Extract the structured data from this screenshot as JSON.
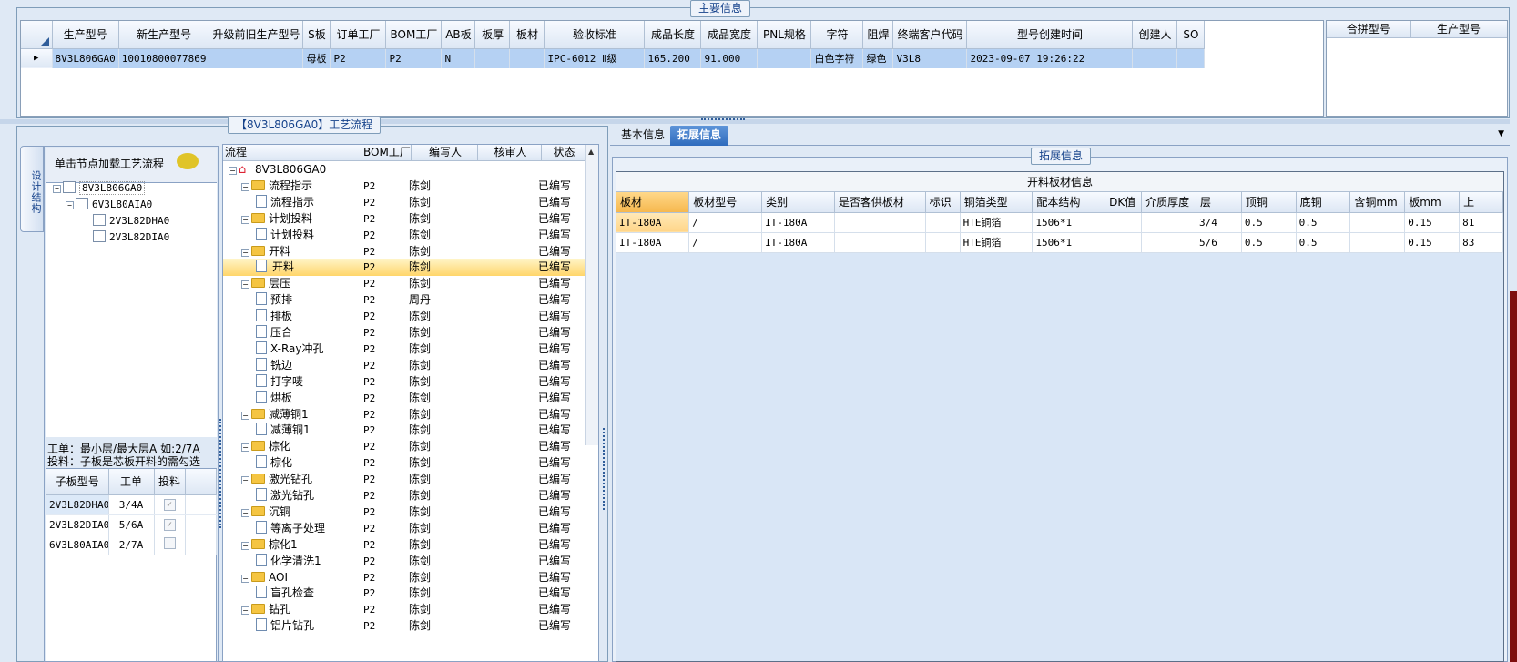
{
  "top": {
    "title": "主要信息",
    "columns": [
      "生产型号",
      "新生产型号",
      "升级前旧生产型号",
      "S板",
      "订单工厂",
      "BOM工厂",
      "AB板",
      "板厚",
      "板材",
      "验收标准",
      "成品长度",
      "成品宽度",
      "PNL规格",
      "字符",
      "阻焊",
      "终端客户代码",
      "型号创建时间",
      "创建人",
      "SO"
    ],
    "row": [
      "8V3L806GA0",
      "10010800077869",
      "",
      "母板",
      "P2",
      "P2",
      "N",
      "",
      "",
      "IPC-6012 Ⅱ级",
      "165.200",
      "91.000",
      "",
      "白色字符",
      "绿色",
      "V3L8",
      "2023-09-07 19:26:22",
      "",
      ""
    ],
    "merge_columns": [
      "合拼型号",
      "生产型号"
    ]
  },
  "process": {
    "title": "【8V3L806GA0】工艺流程",
    "vertical_tab": "设计结构",
    "node_header": "单击节点加载工艺流程",
    "tree": [
      "8V3L806GA0",
      "6V3L80AIA0",
      "2V3L82DHA0",
      "2V3L82DIA0"
    ],
    "note_line1": "工单：最小层/最大层A 如:2/7A",
    "note_line2": "投料：子板是芯板开料的需勾选",
    "sub_columns": [
      "子板型号",
      "工单",
      "投料"
    ],
    "sub_rows": [
      {
        "model": "2V3L82DHA0",
        "order": "3/4A",
        "checked": "✓"
      },
      {
        "model": "2V3L82DIA0",
        "order": "5/6A",
        "checked": "✓"
      },
      {
        "model": "6V3L80AIA0",
        "order": "2/7A",
        "checked": ""
      }
    ],
    "flow_columns": [
      "流程",
      "BOM工厂",
      "编写人",
      "核审人",
      "状态"
    ],
    "flow_rows": [
      {
        "name": "8V3L806GA0",
        "bom": "",
        "writer": "",
        "status": ""
      },
      {
        "name": "流程指示",
        "bom": "P2",
        "writer": "陈剑",
        "status": "已编写"
      },
      {
        "name": "流程指示",
        "bom": "P2",
        "writer": "陈剑",
        "status": "已编写"
      },
      {
        "name": "计划投料",
        "bom": "P2",
        "writer": "陈剑",
        "status": "已编写"
      },
      {
        "name": "计划投料",
        "bom": "P2",
        "writer": "陈剑",
        "status": "已编写"
      },
      {
        "name": "开料",
        "bom": "P2",
        "writer": "陈剑",
        "status": "已编写"
      },
      {
        "name": "开料",
        "bom": "P2",
        "writer": "陈剑",
        "status": "已编写"
      },
      {
        "name": "层压",
        "bom": "P2",
        "writer": "陈剑",
        "status": "已编写"
      },
      {
        "name": "预排",
        "bom": "P2",
        "writer": "周丹",
        "status": "已编写"
      },
      {
        "name": "排板",
        "bom": "P2",
        "writer": "陈剑",
        "status": "已编写"
      },
      {
        "name": "压合",
        "bom": "P2",
        "writer": "陈剑",
        "status": "已编写"
      },
      {
        "name": "X-Ray冲孔",
        "bom": "P2",
        "writer": "陈剑",
        "status": "已编写"
      },
      {
        "name": "铣边",
        "bom": "P2",
        "writer": "陈剑",
        "status": "已编写"
      },
      {
        "name": "打字唛",
        "bom": "P2",
        "writer": "陈剑",
        "status": "已编写"
      },
      {
        "name": "烘板",
        "bom": "P2",
        "writer": "陈剑",
        "status": "已编写"
      },
      {
        "name": "减薄铜1",
        "bom": "P2",
        "writer": "陈剑",
        "status": "已编写"
      },
      {
        "name": "减薄铜1",
        "bom": "P2",
        "writer": "陈剑",
        "status": "已编写"
      },
      {
        "name": "棕化",
        "bom": "P2",
        "writer": "陈剑",
        "status": "已编写"
      },
      {
        "name": "棕化",
        "bom": "P2",
        "writer": "陈剑",
        "status": "已编写"
      },
      {
        "name": "激光钻孔",
        "bom": "P2",
        "writer": "陈剑",
        "status": "已编写"
      },
      {
        "name": "激光钻孔",
        "bom": "P2",
        "writer": "陈剑",
        "status": "已编写"
      },
      {
        "name": "沉铜",
        "bom": "P2",
        "writer": "陈剑",
        "status": "已编写"
      },
      {
        "name": "等离子处理",
        "bom": "P2",
        "writer": "陈剑",
        "status": "已编写"
      },
      {
        "name": "棕化1",
        "bom": "P2",
        "writer": "陈剑",
        "status": "已编写"
      },
      {
        "name": "化学清洗1",
        "bom": "P2",
        "writer": "陈剑",
        "status": "已编写"
      },
      {
        "name": "AOI",
        "bom": "P2",
        "writer": "陈剑",
        "status": "已编写"
      },
      {
        "name": "盲孔检查",
        "bom": "P2",
        "writer": "陈剑",
        "status": "已编写"
      },
      {
        "name": "钻孔",
        "bom": "P2",
        "writer": "陈剑",
        "status": "已编写"
      },
      {
        "name": "铝片钻孔",
        "bom": "P2",
        "writer": "陈剑",
        "status": "已编写"
      }
    ]
  },
  "tabs": [
    "基本信息",
    "拓展信息"
  ],
  "ext": {
    "group_title": "拓展信息",
    "cut_title": "开料板材信息",
    "columns": [
      "板材",
      "板材型号",
      "类别",
      "是否客供板材",
      "标识",
      "铜箔类型",
      "配本结构",
      "DK值",
      "介质厚度",
      "层",
      "顶铜",
      "底铜",
      "含铜mm",
      "板mm",
      "上"
    ],
    "rows": [
      [
        "IT-180A",
        "/",
        "IT-180A",
        "",
        "",
        "HTE铜箔",
        "1506*1",
        "",
        "",
        "3/4",
        "0.5",
        "0.5",
        "",
        "0.15",
        "81"
      ],
      [
        "IT-180A",
        "/",
        "IT-180A",
        "",
        "",
        "HTE铜箔",
        "1506*1",
        "",
        "",
        "5/6",
        "0.5",
        "0.5",
        "",
        "0.15",
        "83"
      ]
    ]
  },
  "colors": {
    "selection": "#b5d1f3",
    "accent": "#2f6bbd",
    "highlight": "#ffd56a"
  }
}
